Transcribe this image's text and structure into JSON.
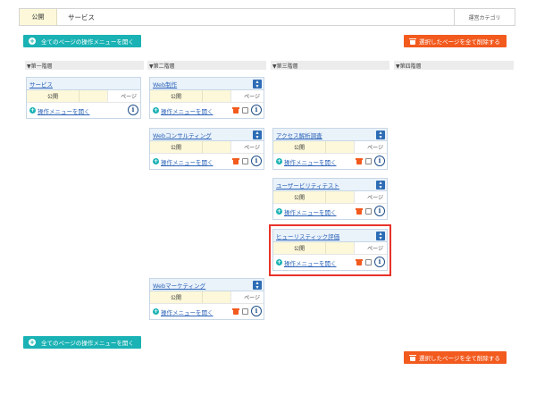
{
  "topbar": {
    "status": "公開",
    "title": "サービス",
    "category_label": "運営カテゴリ"
  },
  "actions": {
    "open_all_label": "全てのページの操作メニューを開く",
    "delete_selected_label": "選択したページを全て削除する"
  },
  "columns": [
    "▼第一階層",
    "▼第二階層",
    "▼第三階層",
    "▼第四階層"
  ],
  "cards": [
    {
      "title": "サービス",
      "status": "公開",
      "type": "ページ",
      "menu_label": "操作メニューを開く"
    },
    {
      "title": "Web制作",
      "status": "公開",
      "type": "ページ",
      "menu_label": "操作メニューを開く"
    },
    {
      "title": "Webコンサルティング",
      "status": "公開",
      "type": "ページ",
      "menu_label": "操作メニューを開く"
    },
    {
      "title": "アクセス解析調査",
      "status": "公開",
      "type": "ページ",
      "menu_label": "操作メニューを開く"
    },
    {
      "title": "ユーザービリティテスト",
      "status": "公開",
      "type": "ページ",
      "menu_label": "操作メニューを開く"
    },
    {
      "title": "ヒューリスティック評価",
      "status": "公開",
      "type": "ページ",
      "menu_label": "操作メニューを開く"
    },
    {
      "title": "Webマーケティング",
      "status": "公開",
      "type": "ページ",
      "menu_label": "操作メニューを開く"
    }
  ],
  "icons": {
    "plus": "plus-circle-icon",
    "trash": "trash-icon",
    "sort": "sort-arrows-icon",
    "info": "info-icon"
  },
  "colors": {
    "accent_teal": "#1ab2b4",
    "danger_orange": "#f25a1e",
    "highlight_red": "#e8332a",
    "link_blue": "#2b63b8"
  }
}
